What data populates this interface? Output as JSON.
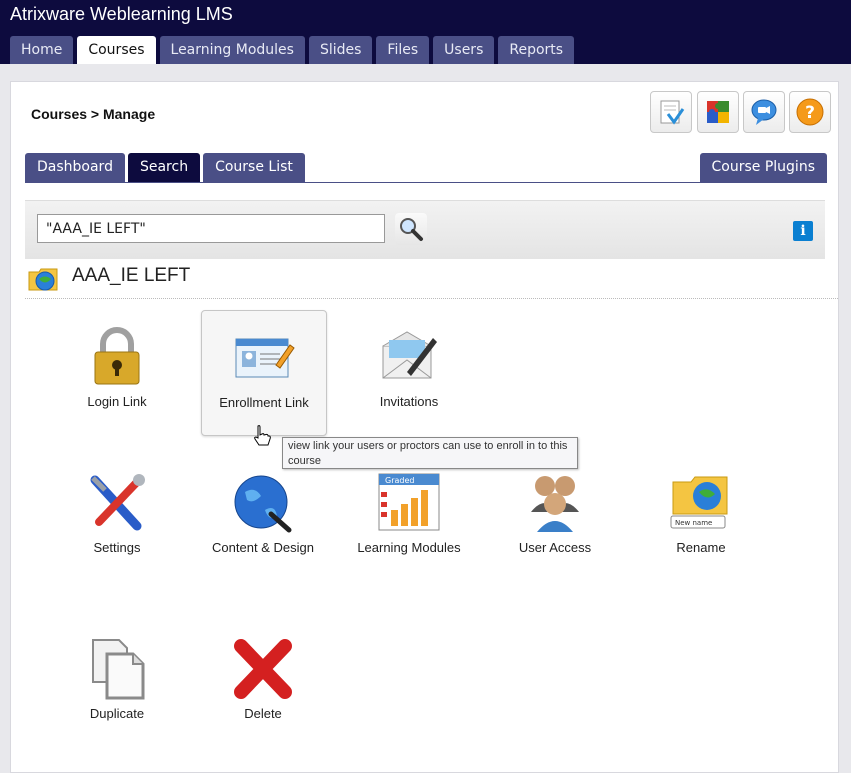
{
  "app": {
    "title": "Atrixware Weblearning LMS"
  },
  "nav": {
    "tabs": [
      {
        "label": "Home"
      },
      {
        "label": "Courses"
      },
      {
        "label": "Learning Modules"
      },
      {
        "label": "Slides"
      },
      {
        "label": "Files"
      },
      {
        "label": "Users"
      },
      {
        "label": "Reports"
      }
    ],
    "active": "Courses"
  },
  "breadcrumb": "Courses > Manage",
  "toolbar": {
    "icons": [
      "notepad-icon",
      "puzzle-icon",
      "chat-bubble-icon",
      "help-icon"
    ]
  },
  "subtabs": {
    "left": [
      {
        "label": "Dashboard"
      },
      {
        "label": "Search"
      },
      {
        "label": "Course List"
      }
    ],
    "active": "Search",
    "right": "Course Plugins"
  },
  "search": {
    "value": "\"AAA_IE LEFT\"",
    "icon": "magnifier-icon",
    "info_label": "i"
  },
  "course": {
    "name": "AAA_IE LEFT",
    "icon": "course-globe-icon"
  },
  "actions": [
    {
      "label": "Login Link",
      "icon": "lock-icon"
    },
    {
      "label": "Enrollment Link",
      "icon": "enrollment-card-icon"
    },
    {
      "label": "Invitations",
      "icon": "envelope-pen-icon"
    },
    {
      "label": "Settings",
      "icon": "tools-icon"
    },
    {
      "label": "Content & Design",
      "icon": "globe-brush-icon"
    },
    {
      "label": "Learning Modules",
      "icon": "graded-chart-icon"
    },
    {
      "label": "User Access",
      "icon": "users-icon"
    },
    {
      "label": "Rename",
      "icon": "rename-folder-icon"
    },
    {
      "label": "Duplicate",
      "icon": "duplicate-icon"
    },
    {
      "label": "Delete",
      "icon": "delete-x-icon"
    }
  ],
  "tooltip": "view link your users or proctors can use to enroll in to this course",
  "graded_label": "Graded",
  "new_name_label": "New name",
  "colors": {
    "topbar": "#0d0b3e",
    "tab": "#4a4f86",
    "accent": "#0a7fd1"
  }
}
